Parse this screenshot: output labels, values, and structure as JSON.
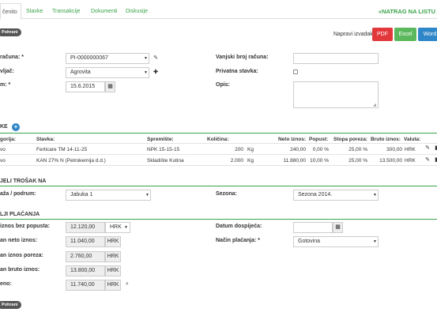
{
  "tabs": [
    {
      "label": "čenito"
    },
    {
      "label": "Stavke"
    },
    {
      "label": "Transakcije"
    },
    {
      "label": "Dokumenti"
    },
    {
      "label": "Diskusije"
    }
  ],
  "back_link": "NATRAG NA LISTU",
  "back_icon": "double-chevron-left-icon",
  "save_top": "Pohrani",
  "save_bottom": "Pohrani",
  "report": {
    "label": "Napravi izvadak:",
    "pdf": "PDF",
    "excel": "Excel",
    "word": "Word",
    "colors": {
      "pdf": "#e2383c",
      "excel": "#5cb85c",
      "word": "#2f86c8"
    }
  },
  "form": {
    "invoice_label": "računa: *",
    "invoice_value": "PI-0000000067",
    "supplier_label": "vljač:",
    "supplier_value": "Agrovita",
    "date_label": "m: *",
    "date_value": "15.6.2015",
    "external_label": "Vanjski broj računa:",
    "external_value": "",
    "private_label": "Privatna stavka:",
    "private_checked": false,
    "desc_label": "Opis:",
    "desc_value": ""
  },
  "items": {
    "title": "KE",
    "headers": {
      "category": "gorija:",
      "item": "Stavka:",
      "storage": "Spremište:",
      "quantity": "Količina:",
      "net": "Neto iznos:",
      "discount": "Popust:",
      "tax_rate": "Stopa poreza:",
      "gross": "Bruto iznos:",
      "currency": "Valuta:"
    },
    "rows": [
      {
        "category": "vo",
        "item": "Ferticare TM 14-11-25",
        "storage": "NPK 15-15-15",
        "qty": "200",
        "unit": "Kg",
        "net": "240,00",
        "discount": "0,00 %",
        "tax": "25,00 %",
        "gross": "300,00",
        "currency": "HRK"
      },
      {
        "category": "vo",
        "item": "KAN 27% N (Petrokemija d.d.)",
        "storage": "Skladište Kutina",
        "qty": "2.000",
        "unit": "Kg",
        "net": "11.880,00",
        "discount": "10,00 %",
        "tax": "25,00 %",
        "gross": "13.500,00",
        "currency": "HRK"
      }
    ]
  },
  "cost": {
    "title": "JELI TROŠAK NA",
    "orchard_label": "aža / podrum:",
    "orchard_value": "Jabuka 1",
    "season_label": "Sezona:",
    "season_value": "Sezona 2014."
  },
  "payment": {
    "title": "LJI PLAĆANJA",
    "gross_wo_label": "iznos bez popusta:",
    "gross_wo_value": "12.120,00",
    "gross_wo_currency": "HRK",
    "net_label": "an neto iznos:",
    "net_value": "11.040,00",
    "net_currency": "HRK",
    "tax_label": "an iznos poreza:",
    "tax_value": "2.760,00",
    "tax_currency": "HRK",
    "gross_label": "an bruto iznos:",
    "gross_value": "13.800,00",
    "gross_currency": "HRK",
    "total_label": "eno:",
    "total_value": "11.740,00",
    "total_currency": "HRK",
    "due_label": "Datum dospijeća:",
    "due_value": "",
    "method_label": "Način plaćanja: *",
    "method_value": "Gotovina"
  }
}
